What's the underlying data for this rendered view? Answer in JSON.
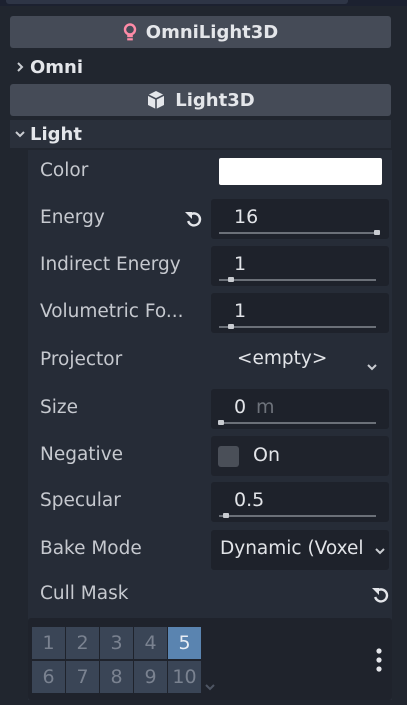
{
  "headers": {
    "omnilight": "OmniLight3D",
    "light3d": "Light3D"
  },
  "sections": {
    "omni": "Omni",
    "light": "Light"
  },
  "properties": {
    "color": {
      "label": "Color",
      "value": "#ffffff"
    },
    "energy": {
      "label": "Energy",
      "value": "16",
      "slider_fraction": 1.0
    },
    "indirect_energy": {
      "label": "Indirect Energy",
      "value": "1",
      "slider_fraction": 0.06
    },
    "volumetric_fog": {
      "label": "Volumetric Fo...",
      "value": "1",
      "slider_fraction": 0.06
    },
    "projector": {
      "label": "Projector",
      "value": "<empty>"
    },
    "size": {
      "label": "Size",
      "value": "0",
      "unit": "m",
      "slider_fraction": 0.0
    },
    "negative": {
      "label": "Negative",
      "checkbox_label": "On",
      "checked": false
    },
    "specular": {
      "label": "Specular",
      "value": "0.5",
      "slider_fraction": 0.03
    },
    "bake_mode": {
      "label": "Bake Mode",
      "value": "Dynamic (Voxel"
    },
    "cull_mask": {
      "label": "Cull Mask",
      "layers": [
        "1",
        "2",
        "3",
        "4",
        "5",
        "6",
        "7",
        "8",
        "9",
        "10"
      ],
      "active_layers": [
        "5"
      ]
    }
  },
  "icons": {
    "omnilight": "lightbulb-icon",
    "light3d": "cube-icon",
    "revert": "revert-icon",
    "dropdown": "chevron-down-icon",
    "menu": "vertical-ellipsis-icon"
  },
  "colors": {
    "accent": "#5a84b0",
    "light_icon": "#ff8ba7"
  }
}
